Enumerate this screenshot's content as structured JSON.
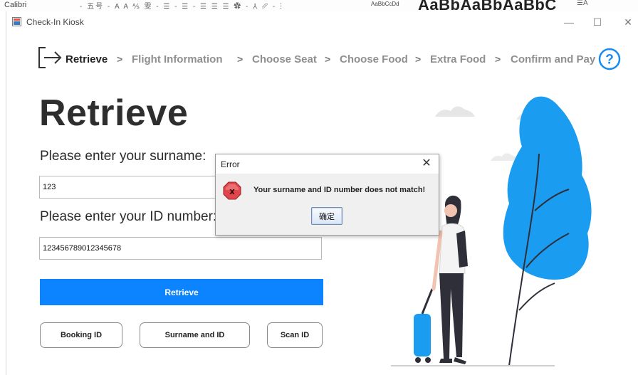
{
  "background_ribbon": {
    "font_name": "Calibri",
    "glyphs": "- 五号  - A  A  ⅍ 雯 -  ☰ -  ☰ -  ☰  ☰  ☰  ✿ -  ⅄  ␥ - ⵗ",
    "style_preview_small": "AaBbCcDd",
    "style_preview_big": "AaBbAaBbAaBbC",
    "right_glyph": "☰A"
  },
  "window": {
    "title": "Check-In Kiosk",
    "minimize": "—",
    "maximize": "☐",
    "close": "✕"
  },
  "breadcrumb": {
    "steps": [
      "Retrieve",
      "Flight Information",
      "Choose Seat",
      "Choose Food",
      "Extra Food",
      "Confirm and Pay"
    ],
    "separator": ">",
    "active_index": 0
  },
  "form": {
    "title": "Retrieve",
    "surname_label": "Please enter your surname:",
    "surname_value": "123",
    "id_label": "Please enter your ID number:",
    "id_value": "123456789012345678",
    "retrieve_button": "Retrieve",
    "booking_id_button": "Booking ID",
    "surname_and_id_button": "Surname and ID",
    "scan_id_button": "Scan ID"
  },
  "dialog": {
    "title": "Error",
    "close": "✕",
    "message": "Your surname and ID number does not match!",
    "ok_button": "确定"
  },
  "colors": {
    "accent_blue": "#0d84ff",
    "tree_blue": "#1a9cf0",
    "error_red": "#d9343a"
  },
  "icons": [
    "exit-icon",
    "help-icon",
    "error-icon",
    "app-icon"
  ]
}
